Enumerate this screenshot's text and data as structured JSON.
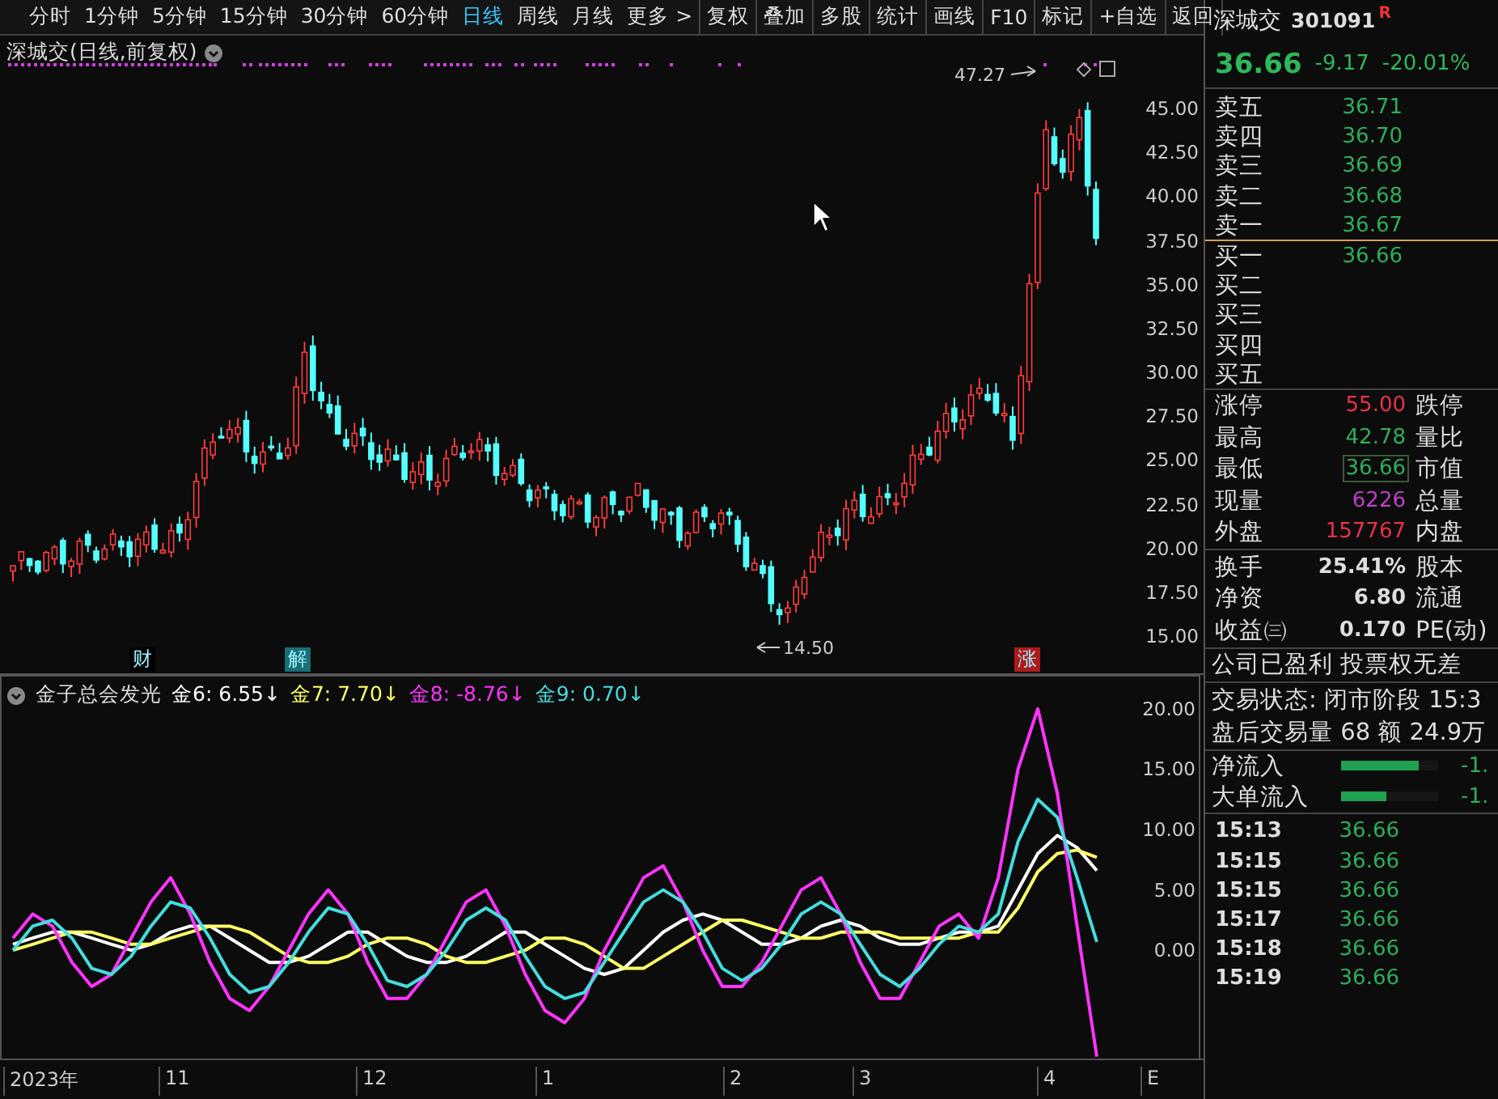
{
  "toolbar": {
    "periods": [
      {
        "label": "分时",
        "selected": false
      },
      {
        "label": "1分钟",
        "selected": false
      },
      {
        "label": "5分钟",
        "selected": false
      },
      {
        "label": "15分钟",
        "selected": false
      },
      {
        "label": "30分钟",
        "selected": false
      },
      {
        "label": "60分钟",
        "selected": false
      },
      {
        "label": "日线",
        "selected": true
      },
      {
        "label": "周线",
        "selected": false
      },
      {
        "label": "月线",
        "selected": false
      },
      {
        "label": "更多 >",
        "selected": false
      }
    ],
    "actions": [
      "复权",
      "叠加",
      "多股",
      "统计",
      "画线",
      "F10",
      "标记",
      "+自选",
      "返回"
    ]
  },
  "chart": {
    "title": "深城交(日线,前复权)",
    "y_ticks": [
      "45.00",
      "42.50",
      "40.00",
      "37.50",
      "35.00",
      "32.50",
      "30.00",
      "27.50",
      "25.00",
      "22.50",
      "20.00",
      "17.50",
      "15.00"
    ],
    "high_label": "47.27",
    "low_label": "14.50",
    "markers": [
      {
        "text": "财",
        "color": "#000000"
      },
      {
        "text": "解",
        "color": "#1a6e75"
      },
      {
        "text": "涨",
        "color": "#b01a1a"
      }
    ]
  },
  "indicator": {
    "name": "金子总会发光",
    "lines": [
      {
        "label": "金6: 6.55↓",
        "color": "#ffffff"
      },
      {
        "label": "金7: 7.70↓",
        "color": "#ffff66"
      },
      {
        "label": "金8: -8.76↓",
        "color": "#ff33ff"
      },
      {
        "label": "金9: 0.70↓",
        "color": "#44dddd"
      }
    ],
    "chart_data": {
      "type": "line",
      "ylim": [
        -9.1,
        22.8
      ],
      "yticks": [
        {
          "value": 20,
          "label": "20.00"
        },
        {
          "value": 15,
          "label": "15.00"
        },
        {
          "value": 10,
          "label": "10.00"
        },
        {
          "value": 5,
          "label": "5.00"
        },
        {
          "value": 0,
          "label": "0.00"
        }
      ],
      "series": [
        {
          "color": "#ffffff",
          "values": [
            0.5,
            1,
            1.5,
            1.5,
            1,
            0.5,
            0,
            0.5,
            1.5,
            2,
            2,
            1,
            0,
            -1,
            -1,
            -0.5,
            0.5,
            1.5,
            1.5,
            0.5,
            -0.5,
            -1,
            -1,
            -0.5,
            0.5,
            1.5,
            1.5,
            0.5,
            -0.5,
            -1.5,
            -2,
            -1.5,
            0,
            1.5,
            2.5,
            3,
            2.5,
            1.5,
            0.5,
            0.5,
            1,
            2,
            2.5,
            2,
            1,
            0.5,
            0.5,
            1,
            1.5,
            1.5,
            2,
            5,
            8,
            9.5,
            8.5,
            6.6
          ]
        },
        {
          "color": "#ffff66",
          "values": [
            0,
            0.5,
            1,
            1.5,
            1.5,
            1,
            0.5,
            0.5,
            1,
            1.5,
            2,
            2,
            1.5,
            0.5,
            -0.5,
            -1,
            -1,
            -0.5,
            0.5,
            1,
            1,
            0.5,
            -0.5,
            -1,
            -1,
            -0.5,
            0,
            1,
            1,
            0.5,
            -0.5,
            -1.5,
            -1.5,
            -0.5,
            0.5,
            1.5,
            2.5,
            2.5,
            2,
            1.5,
            1,
            1,
            1.5,
            1.5,
            1.5,
            1,
            1,
            1,
            1,
            1.5,
            1.5,
            3.5,
            6.5,
            8,
            8.3,
            7.7
          ]
        },
        {
          "color": "#ff33ff",
          "values": [
            1,
            3,
            2,
            -1,
            -3,
            -2,
            1,
            4,
            6,
            3,
            -1,
            -4,
            -5,
            -3,
            0,
            3,
            5,
            3,
            -1,
            -4,
            -4,
            -2,
            1,
            4,
            5,
            2,
            -2,
            -5,
            -6,
            -4,
            0,
            3,
            6,
            7,
            4,
            0,
            -3,
            -3,
            -1,
            2,
            5,
            6,
            3,
            -1,
            -4,
            -4,
            -1,
            2,
            3,
            1,
            6,
            15,
            20,
            13,
            2,
            -8.8
          ]
        },
        {
          "color": "#44dddd",
          "values": [
            0,
            2,
            2.5,
            1,
            -1.5,
            -2,
            -0.5,
            2,
            4,
            3.5,
            1,
            -2,
            -3.5,
            -3,
            -1,
            1.5,
            3.5,
            3,
            0.5,
            -2.5,
            -3,
            -2,
            0,
            2.5,
            3.5,
            2.5,
            -0.5,
            -3,
            -4,
            -3.5,
            -1,
            1.5,
            4,
            5,
            4,
            1.5,
            -1.5,
            -2.5,
            -1.5,
            0.5,
            3,
            4,
            3,
            0.5,
            -2,
            -3,
            -1.5,
            0.5,
            2,
            1.5,
            3,
            9,
            12.5,
            11,
            6,
            0.7
          ]
        }
      ]
    }
  },
  "x_axis": [
    "2023年",
    "11",
    "12",
    "1",
    "2",
    "3",
    "4",
    "E"
  ],
  "quote": {
    "name": "深城交",
    "code": "301091",
    "badge": "R",
    "price": "36.66",
    "change": "-9.17",
    "change_pct": "-20.01%",
    "asks": [
      {
        "label": "卖五",
        "price": "36.71"
      },
      {
        "label": "卖四",
        "price": "36.70"
      },
      {
        "label": "卖三",
        "price": "36.69"
      },
      {
        "label": "卖二",
        "price": "36.68"
      },
      {
        "label": "卖一",
        "price": "36.67"
      }
    ],
    "bids": [
      {
        "label": "买一",
        "price": "36.66"
      },
      {
        "label": "买二"
      },
      {
        "label": "买三"
      },
      {
        "label": "买四"
      },
      {
        "label": "买五"
      }
    ],
    "stats": [
      {
        "label": "涨停",
        "value": "55.00",
        "color": "#e8334a",
        "boxed": false,
        "label2": "跌停"
      },
      {
        "label": "最高",
        "value": "42.78",
        "color": "#2fae5a",
        "boxed": false,
        "label2": "量比"
      },
      {
        "label": "最低",
        "value": "36.66",
        "color": "#2fae5a",
        "boxed": true,
        "label2": "市值"
      },
      {
        "label": "现量",
        "value": "6226",
        "color": "#c040c8",
        "boxed": false,
        "label2": "总量"
      },
      {
        "label": "外盘",
        "value": "157767",
        "color": "#e8334a",
        "boxed": false,
        "label2": "内盘"
      }
    ],
    "fundamentals": [
      {
        "label": "换手",
        "value": "25.41%",
        "label2": "股本"
      },
      {
        "label": "净资",
        "value": "6.80",
        "label2": "流通"
      },
      {
        "label": "收益㈢",
        "value": "0.170",
        "label2": "PE(动)"
      }
    ],
    "notice": "公司已盈利 投票权无差",
    "status": "交易状态: 闭市阶段 15:3",
    "after_hours": "盘后交易量 68 额 24.9万",
    "flows": [
      {
        "label": "净流入",
        "level": 0.8,
        "value": "-1."
      },
      {
        "label": "大单流入",
        "level": 0.47,
        "value": "-1."
      }
    ],
    "ticks": [
      {
        "time": "15:13",
        "price": "36.66"
      },
      {
        "time": "15:15",
        "price": "36.66"
      },
      {
        "time": "15:15",
        "price": "36.66"
      },
      {
        "time": "15:17",
        "price": "36.66"
      },
      {
        "time": "15:18",
        "price": "36.66"
      },
      {
        "time": "15:19",
        "price": "36.66"
      }
    ]
  }
}
